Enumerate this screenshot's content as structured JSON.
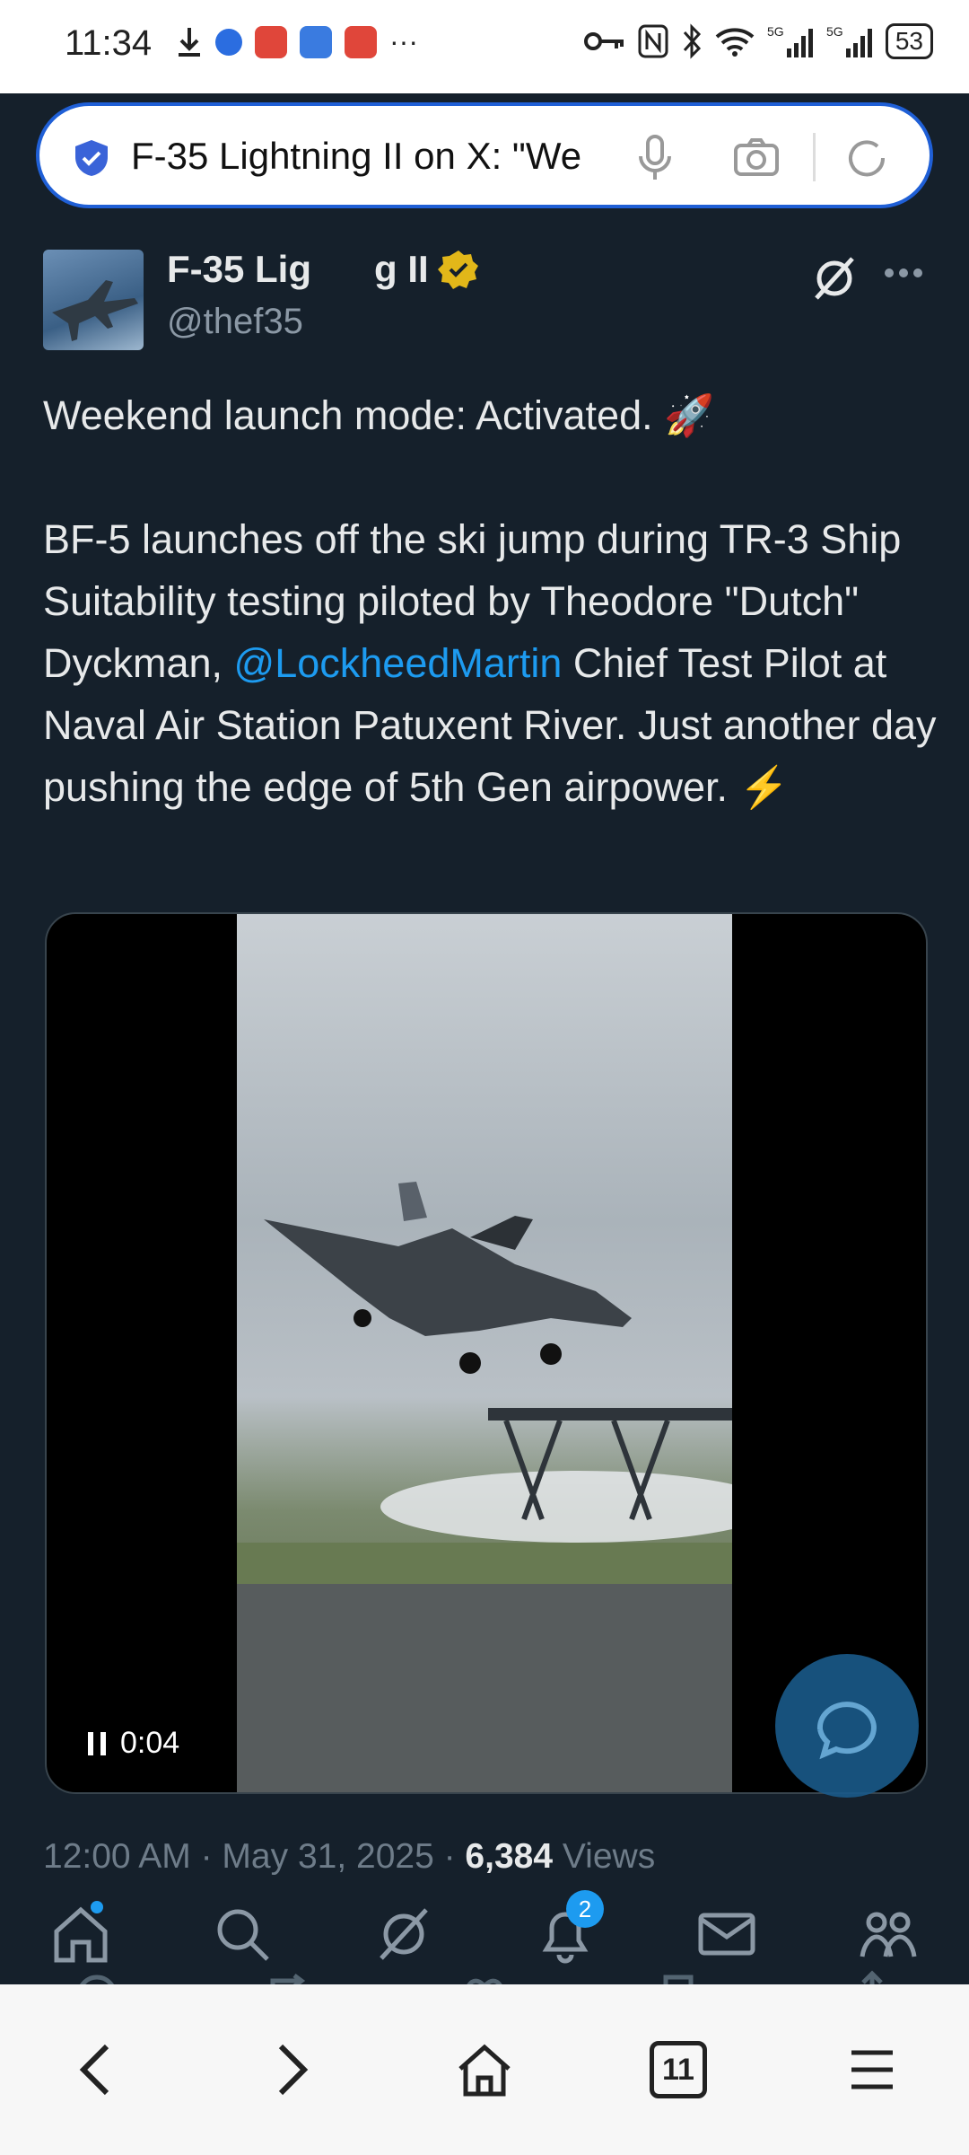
{
  "status_bar": {
    "time": "11:34",
    "battery": "53"
  },
  "browser": {
    "url_text": "F-35 Lightning II on X: \"We",
    "tabs_count": "11"
  },
  "tweet": {
    "display_name": "F-35 Lig      g II",
    "handle": "@thef35",
    "text_line1": "Weekend launch mode: Activated. 🚀",
    "text_p2_before": "BF-5 launches off the ski jump during TR-3 Ship Suitability testing piloted by Theodore \"Dutch\" Dyckman, ",
    "mention": "@LockheedMartin",
    "text_p2_after": " Chief Test Pilot at Naval Air Station Patuxent River. Just another day pushing the edge of 5th Gen airpower. ⚡",
    "video_time": "0:04",
    "timestamp": "12:00 AM · May 31, 2025 · ",
    "views_count": "6,384",
    "views_label": " Views"
  },
  "tabbar": {
    "notifications_badge": "2"
  },
  "colors": {
    "background": "#15202b",
    "accent": "#1d9bf0",
    "muted": "#8b98a5"
  }
}
